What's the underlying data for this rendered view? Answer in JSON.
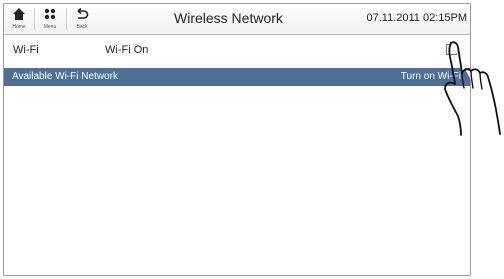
{
  "topbar": {
    "home_label": "Home",
    "menu_label": "Menu",
    "back_label": "Back",
    "title": "Wireless Network",
    "clock": "07.11.2011 02:15PM"
  },
  "wifi": {
    "label": "Wi-Fi",
    "status": "Wi-Fi On",
    "checked": false
  },
  "available": {
    "label": "Available Wi-Fi Network",
    "hint": "Turn on Wi-Fi"
  },
  "icons": {
    "home": "home-icon",
    "menu": "menu-icon",
    "back": "back-icon",
    "hand": "hand-pointer-icon"
  }
}
